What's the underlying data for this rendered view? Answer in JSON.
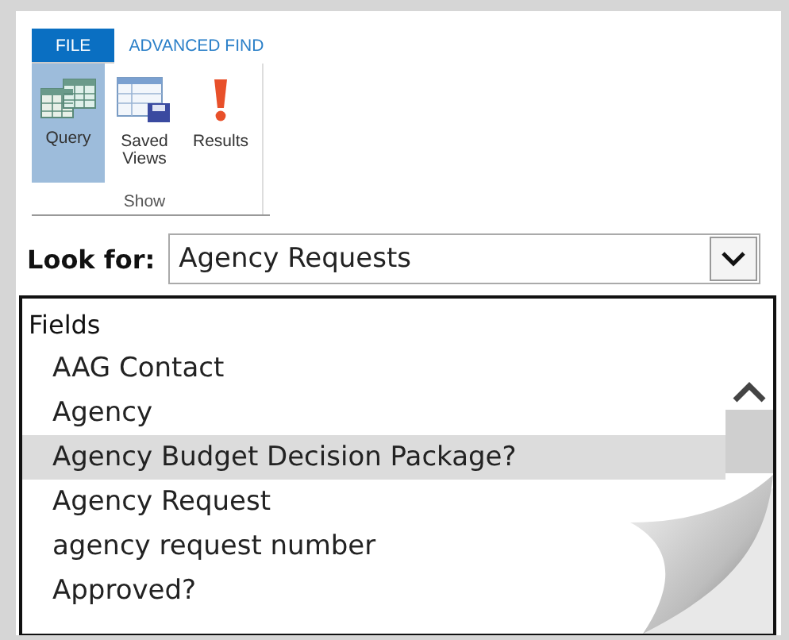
{
  "ribbon": {
    "tabs": [
      {
        "label": "FILE",
        "kind": "file",
        "selected": false
      },
      {
        "label": "ADVANCED FIND",
        "kind": "tab",
        "selected": true
      }
    ],
    "groups": [
      {
        "label": "Show",
        "buttons": [
          {
            "label": "Query",
            "kind": "query",
            "selected": true
          },
          {
            "label": "Saved Views",
            "kind": "views",
            "selected": false
          },
          {
            "label": "Results",
            "kind": "results",
            "selected": false
          }
        ]
      }
    ]
  },
  "look_for": {
    "label": "Look for:",
    "value": "Agency Requests"
  },
  "fields": {
    "header": "Fields",
    "items": [
      {
        "label": "AAG Contact",
        "selected": false
      },
      {
        "label": "Agency",
        "selected": false
      },
      {
        "label": "Agency Budget Decision Package?",
        "selected": true
      },
      {
        "label": "Agency Request",
        "selected": false
      },
      {
        "label": "agency request number",
        "selected": false
      },
      {
        "label": "Approved?",
        "selected": false
      }
    ]
  }
}
